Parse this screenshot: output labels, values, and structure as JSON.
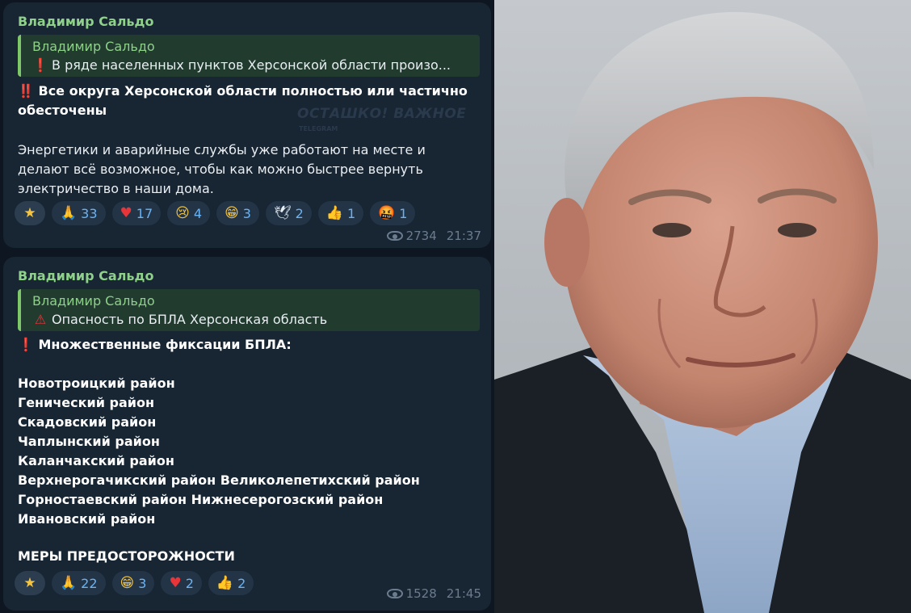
{
  "messages": [
    {
      "author": "Владимир Сальдо",
      "quote": {
        "author": "Владимир Сальдо",
        "icon": "red-exclamation",
        "text": "В ряде населенных пунктов Херсонской области произо..."
      },
      "headline_icon": "‼️",
      "headline": "Все округа Херсонской области полностью или частично обесточены",
      "watermark": "ОСТАШКО! ВАЖНОЕ",
      "watermark_sub": "TELEGRAM",
      "body": "Энергетики и аварийные службы уже работают на месте и делают всё возможное, чтобы как можно быстрее вернуть электричество в наши дома.",
      "reactions": [
        {
          "icon": "star-icon",
          "glyph": "★",
          "count": ""
        },
        {
          "icon": "pray-icon",
          "glyph": "🙏",
          "count": "33"
        },
        {
          "icon": "heart-icon",
          "glyph": "♥",
          "count": "17"
        },
        {
          "icon": "cry-icon",
          "glyph": "😢",
          "count": "4"
        },
        {
          "icon": "grin-icon",
          "glyph": "😁",
          "count": "3"
        },
        {
          "icon": "dove-icon",
          "glyph": "🕊",
          "count": "2"
        },
        {
          "icon": "thumbs-up-icon",
          "glyph": "👍",
          "count": "1"
        },
        {
          "icon": "rage-icon",
          "glyph": "🤬",
          "count": "1"
        }
      ],
      "views": "2734",
      "time": "21:37"
    },
    {
      "author": "Владимир Сальдо",
      "quote": {
        "author": "Владимир Сальдо",
        "icon": "warning-triangle",
        "text": "Опасность по БПЛА Херсонская область"
      },
      "headline_icon": "❗",
      "headline": "Множественные фиксации БПЛА:",
      "districts": [
        "Новотроицкий район",
        "Генический район",
        "Скадовский район",
        "Чаплынский район",
        "Каланчакский район",
        "Верхнерогачикский район Великолепетихский район",
        "Горностаевский район Нижнесерогозский район",
        "Ивановский район"
      ],
      "footer": "МЕРЫ ПРЕДОСТОРОЖНОСТИ",
      "reactions": [
        {
          "icon": "star-icon",
          "glyph": "★",
          "count": ""
        },
        {
          "icon": "pray-icon",
          "glyph": "🙏",
          "count": "22"
        },
        {
          "icon": "grin-icon",
          "glyph": "😁",
          "count": "3"
        },
        {
          "icon": "heart-icon",
          "glyph": "♥",
          "count": "2"
        },
        {
          "icon": "thumbs-up-icon",
          "glyph": "👍",
          "count": "2"
        }
      ],
      "views": "1528",
      "time": "21:45"
    }
  ],
  "colors": {
    "background": "#0e1621",
    "bubble": "#182533",
    "author": "#8fd18a",
    "reaction_count": "#6ab3f3",
    "meta": "#6b7c8e"
  }
}
